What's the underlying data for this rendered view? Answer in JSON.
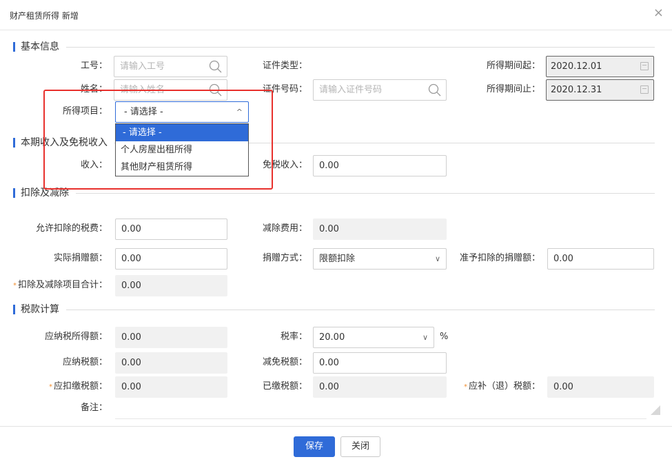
{
  "window": {
    "title": "财产租赁所得 新增",
    "close_glyph": "×"
  },
  "sections": {
    "basic": "基本信息",
    "income": "本期收入及免税收入",
    "deduct": "扣除及减除",
    "tax": "税款计算"
  },
  "basic": {
    "emp_no_label": "工号：",
    "emp_no_placeholder": "请输入工号",
    "name_label": "姓名：",
    "name_placeholder": "请输入姓名",
    "item_label": "所得项目：",
    "cert_type_label": "证件类型：",
    "cert_no_label": "证件号码：",
    "cert_no_placeholder": "请输入证件号码",
    "period_start_label": "所得期间起：",
    "period_start_value": "2020.12.01",
    "period_end_label": "所得期间止：",
    "period_end_value": "2020.12.31"
  },
  "item_select": {
    "selected": "- 请选择 -",
    "chevron": "^",
    "options": [
      "- 请选择 -",
      "个人房屋出租所得",
      "其他财产租赁所得"
    ]
  },
  "income": {
    "income_label": "收入：",
    "exempt_label": "免税收入：",
    "exempt_value": "0.00"
  },
  "deduct": {
    "allowed_tax_label": "允许扣除的税费：",
    "allowed_tax_value": "0.00",
    "reduce_fee_label": "减除费用：",
    "reduce_fee_value": "0.00",
    "donation_label": "实际捐赠额：",
    "donation_value": "0.00",
    "donation_method_label": "捐赠方式：",
    "donation_method_value": "限额扣除",
    "allowed_donation_label": "准予扣除的捐赠额：",
    "allowed_donation_value": "0.00",
    "total_label": "扣除及减除项目合计：",
    "total_value": "0.00"
  },
  "tax": {
    "taxable_income_label": "应纳税所得额：",
    "taxable_income_value": "0.00",
    "rate_label": "税率：",
    "rate_value": "20.00",
    "rate_unit": "%",
    "tax_payable_label": "应纳税额：",
    "tax_payable_value": "0.00",
    "tax_relief_label": "减免税额：",
    "tax_relief_value": "0.00",
    "withhold_label": "应扣缴税额：",
    "withhold_value": "0.00",
    "paid_label": "已缴税额：",
    "paid_value": "0.00",
    "refund_label": "应补（退）税额：",
    "refund_value": "0.00",
    "memo_label": "备注："
  },
  "footer": {
    "save": "保存",
    "close": "关闭"
  },
  "colors": {
    "primary": "#2f6bd8",
    "highlight": "#e8302c",
    "required": "#f19033"
  }
}
